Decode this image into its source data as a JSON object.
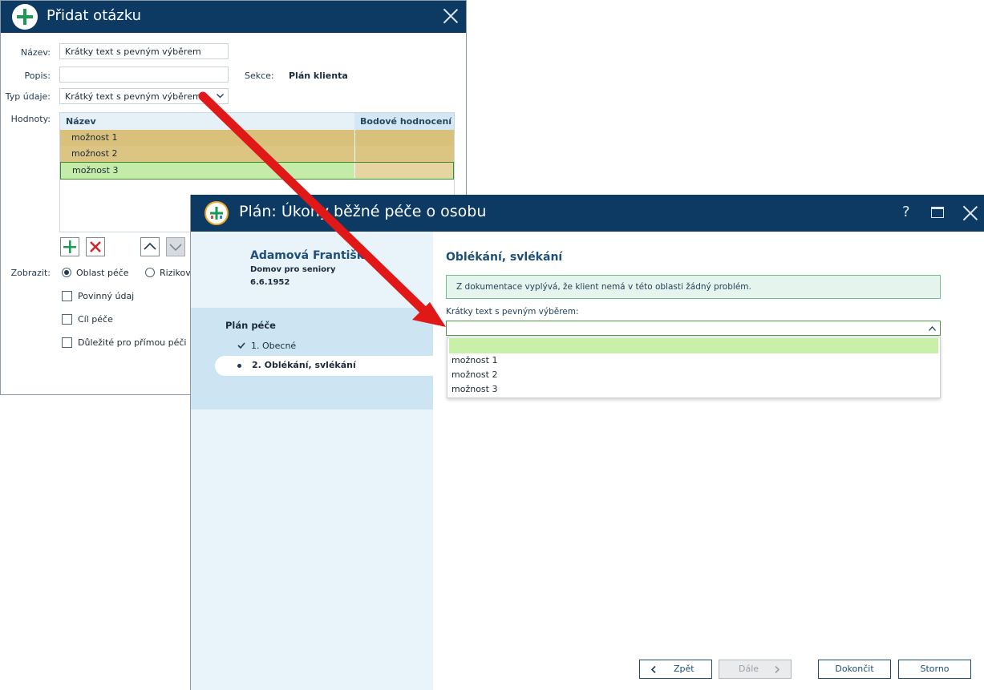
{
  "question_dialog": {
    "title": "Přidat otázku",
    "labels": {
      "name": "Název:",
      "description": "Popis:",
      "data_type": "Typ údaje:",
      "values": "Hodnoty:",
      "section": "Sekce:",
      "display": "Zobrazit:"
    },
    "name_value": "Krátky text s pevným výběrem",
    "description_value": "",
    "section_value": "Plán klienta",
    "data_type_value": "Krátký text s pevným výběrem",
    "grid": {
      "columns": [
        "Název",
        "Bodové hodnocení"
      ],
      "rows": [
        {
          "name": "možnost 1",
          "score": ""
        },
        {
          "name": "možnost 2",
          "score": ""
        },
        {
          "name": "možnost 3",
          "score": ""
        }
      ]
    },
    "display_options": [
      "Oblast péče",
      "Riziková"
    ],
    "checkboxes": [
      "Povinný údaj",
      "Cíl péče",
      "Důležité pro přímou péči"
    ]
  },
  "plan_dialog": {
    "title": "Plán: Úkony běžné péče o osobu",
    "client": {
      "name": "Adamová Františka",
      "facility": "Domov pro seniory",
      "birth_date": "6.6.1952"
    },
    "nav": {
      "section_title": "Plán péče",
      "items": [
        {
          "label": "1. Obecné",
          "state": "done"
        },
        {
          "label": "2. Oblékání, svlékání",
          "state": "current"
        }
      ]
    },
    "page_title": "Oblékání, svlékání",
    "notice": "Z dokumentace vyplývá, že klient nemá v této oblasti žádný problém.",
    "field_label": "Krátky text s pevným výběrem:",
    "dropdown_options": [
      "",
      "možnost 1",
      "možnost 2",
      "možnost 3"
    ],
    "buttons": {
      "back": "Zpět",
      "next": "Dále",
      "finish": "Dokončit",
      "cancel": "Storno"
    },
    "window_controls": {
      "help": "?"
    }
  },
  "colors": {
    "titlebar": "#0d3a62",
    "accent_green": "#1a9a52",
    "annotation_arrow": "#e01818",
    "row_highlight": "#c5eba8",
    "row_tan": "#d9c07b"
  }
}
